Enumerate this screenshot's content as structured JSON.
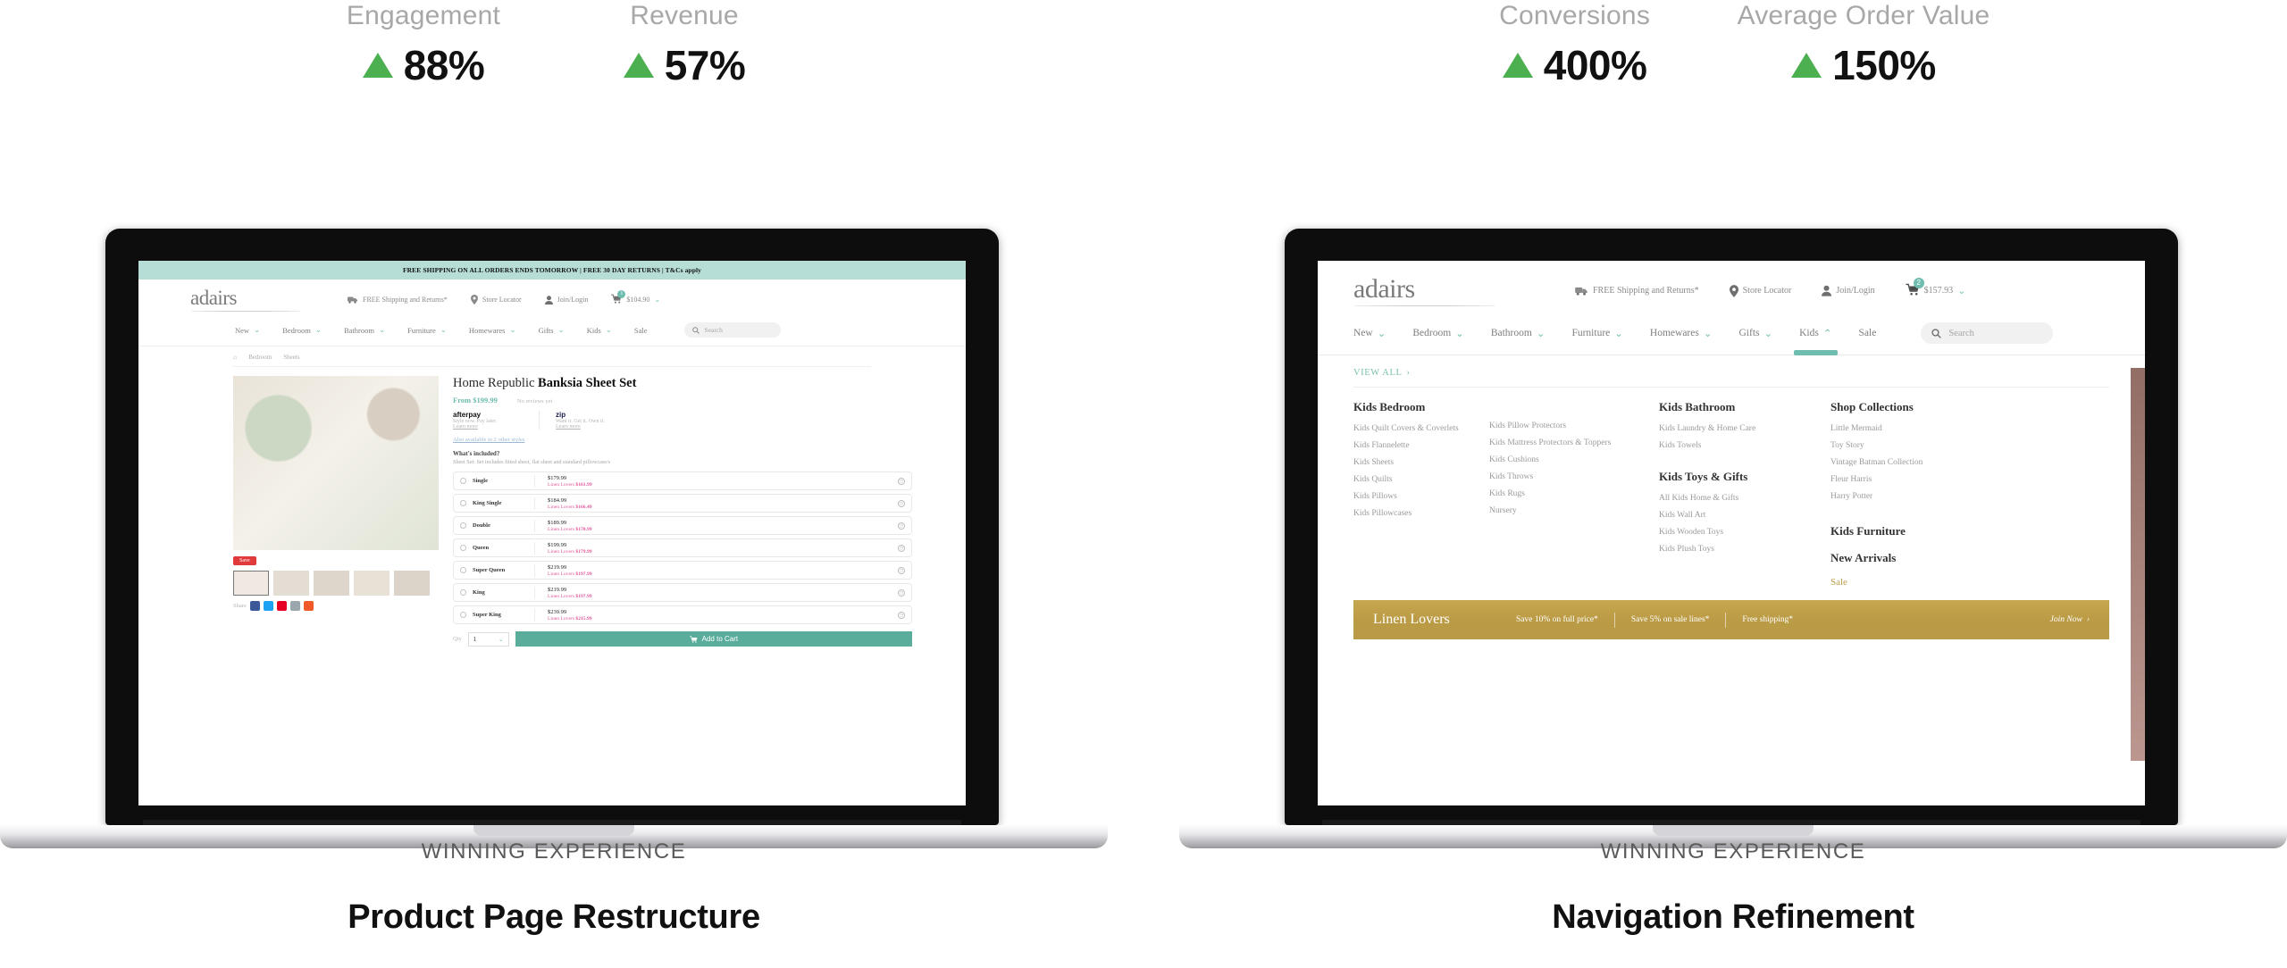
{
  "panels": [
    {
      "metrics": [
        {
          "label": "Engagement",
          "value": "88%",
          "direction": "up",
          "color": "#4caf50"
        },
        {
          "label": "Revenue",
          "value": "57%",
          "direction": "up",
          "color": "#4caf50"
        }
      ],
      "caption": {
        "eyebrow": "WINNING EXPERIENCE",
        "title": "Product Page Restructure"
      },
      "screen": {
        "promo_bar": "FREE SHIPPING ON ALL ORDERS ENDS TOMORROW | FREE 30 DAY RETURNS | T&Cs apply",
        "brand": "adairs",
        "utility": [
          {
            "icon": "truck-icon",
            "label": "FREE Shipping and Returns*"
          },
          {
            "icon": "location-pin-icon",
            "label": "Store Locator"
          },
          {
            "icon": "user-icon",
            "label": "Join/Login"
          },
          {
            "icon": "cart-icon",
            "label": "$104.90",
            "badge": "1"
          }
        ],
        "nav": [
          {
            "label": "New",
            "caret": "down"
          },
          {
            "label": "Bedroom",
            "caret": "down"
          },
          {
            "label": "Bathroom",
            "caret": "down"
          },
          {
            "label": "Furniture",
            "caret": "down"
          },
          {
            "label": "Homewares",
            "caret": "down"
          },
          {
            "label": "Gifts",
            "caret": "down"
          },
          {
            "label": "Kids",
            "caret": "down"
          },
          {
            "label": "Sale",
            "caret": "none"
          }
        ],
        "search_placeholder": "Search",
        "breadcrumbs": [
          "home-icon",
          "Bedroom",
          "Sheets"
        ],
        "product": {
          "brand_line": "Home Republic",
          "name": "Banksia Sheet Set",
          "price_from": "From $199.99",
          "reviews": "No reviews yet",
          "pay_afterpay": "afterpay",
          "pay_afterpay_sub": "Style now. Pay later.",
          "pay_afterpay_link": "Learn more",
          "pay_zip": "zip",
          "pay_zip_sub": "Want it. Get it. Own it.",
          "pay_zip_link": "Learn more",
          "other_styles": "Also available in 2 other styles",
          "included_heading": "What's included?",
          "included_text": "Sheet Set: Set includes fitted sheet, flat sheet and standard pillowcase/s",
          "sale_tag": "Save",
          "share_label": "Share",
          "share_icons": [
            "facebook-icon",
            "twitter-icon",
            "pinterest-icon",
            "email-icon",
            "more-icon"
          ],
          "qty_label": "Qty",
          "qty_value": "1",
          "add_to_cart": "Add to Cart",
          "options": [
            {
              "name": "Single",
              "price": "$179.99",
              "ll_label": "Linen Lovers",
              "ll_price": "$161.99"
            },
            {
              "name": "King Single",
              "price": "$184.99",
              "ll_label": "Linen Lovers",
              "ll_price": "$166.49"
            },
            {
              "name": "Double",
              "price": "$189.99",
              "ll_label": "Linen Lovers",
              "ll_price": "$170.99"
            },
            {
              "name": "Queen",
              "price": "$199.99",
              "ll_label": "Linen Lovers",
              "ll_price": "$179.99"
            },
            {
              "name": "Super Queen",
              "price": "$219.99",
              "ll_label": "Linen Lovers",
              "ll_price": "$197.99"
            },
            {
              "name": "King",
              "price": "$219.99",
              "ll_label": "Linen Lovers",
              "ll_price": "$197.99"
            },
            {
              "name": "Super King",
              "price": "$239.99",
              "ll_label": "Linen Lovers",
              "ll_price": "$215.99"
            }
          ]
        }
      }
    },
    {
      "metrics": [
        {
          "label": "Conversions",
          "value": "400%",
          "direction": "up",
          "color": "#4caf50"
        },
        {
          "label": "Average Order Value",
          "value": "150%",
          "direction": "up",
          "color": "#4caf50"
        }
      ],
      "caption": {
        "eyebrow": "WINNING EXPERIENCE",
        "title": "Navigation Refinement"
      },
      "screen": {
        "brand": "adairs",
        "utility": [
          {
            "icon": "truck-icon",
            "label": "FREE Shipping and Returns*"
          },
          {
            "icon": "location-pin-icon",
            "label": "Store Locator"
          },
          {
            "icon": "user-icon",
            "label": "Join/Login"
          },
          {
            "icon": "cart-icon",
            "label": "$157.93",
            "badge": "2"
          }
        ],
        "nav": [
          {
            "label": "New",
            "caret": "down",
            "active": false
          },
          {
            "label": "Bedroom",
            "caret": "down",
            "active": false
          },
          {
            "label": "Bathroom",
            "caret": "down",
            "active": false
          },
          {
            "label": "Furniture",
            "caret": "down",
            "active": false
          },
          {
            "label": "Homewares",
            "caret": "down",
            "active": false
          },
          {
            "label": "Gifts",
            "caret": "down",
            "active": false
          },
          {
            "label": "Kids",
            "caret": "up",
            "active": true
          },
          {
            "label": "Sale",
            "caret": "none",
            "active": false
          }
        ],
        "search_placeholder": "Search",
        "mega": {
          "view_all": "VIEW ALL",
          "columns": [
            {
              "heading": "Kids Bedroom",
              "items": [
                "Kids Quilt Covers & Coverlets",
                "Kids Flannelette",
                "Kids Sheets",
                "Kids Quilts",
                "Kids Pillows",
                "Kids Pillowcases"
              ]
            },
            {
              "heading": "",
              "items": [
                "Kids Pillow Protectors",
                "Kids Mattress Protectors & Toppers",
                "Kids Cushions",
                "Kids Throws",
                "Kids Rugs",
                "Nursery"
              ]
            },
            {
              "groups": [
                {
                  "heading": "Kids Bathroom",
                  "items": [
                    "Kids Laundry & Home Care",
                    "Kids Towels"
                  ]
                },
                {
                  "heading": "Kids Toys & Gifts",
                  "items": [
                    "All Kids Home & Gifts",
                    "Kids Wall Art",
                    "Kids Wooden Toys",
                    "Kids Plush Toys"
                  ]
                }
              ]
            },
            {
              "groups": [
                {
                  "heading": "Shop Collections",
                  "items": [
                    "Little Mermaid",
                    "Toy Story",
                    "Vintage Batman Collection",
                    "Fleur Harris",
                    "Harry Potter"
                  ]
                },
                {
                  "heading": "Kids Furniture",
                  "items": []
                },
                {
                  "heading": "New Arrivals",
                  "items": []
                }
              ],
              "sale_link": "Sale"
            }
          ],
          "gold_banner": {
            "title": "Linen Lovers",
            "benefits": [
              "Save 10% on full price*",
              "Save 5% on sale lines*",
              "Free shipping*"
            ],
            "cta": "Join Now"
          }
        }
      }
    }
  ]
}
